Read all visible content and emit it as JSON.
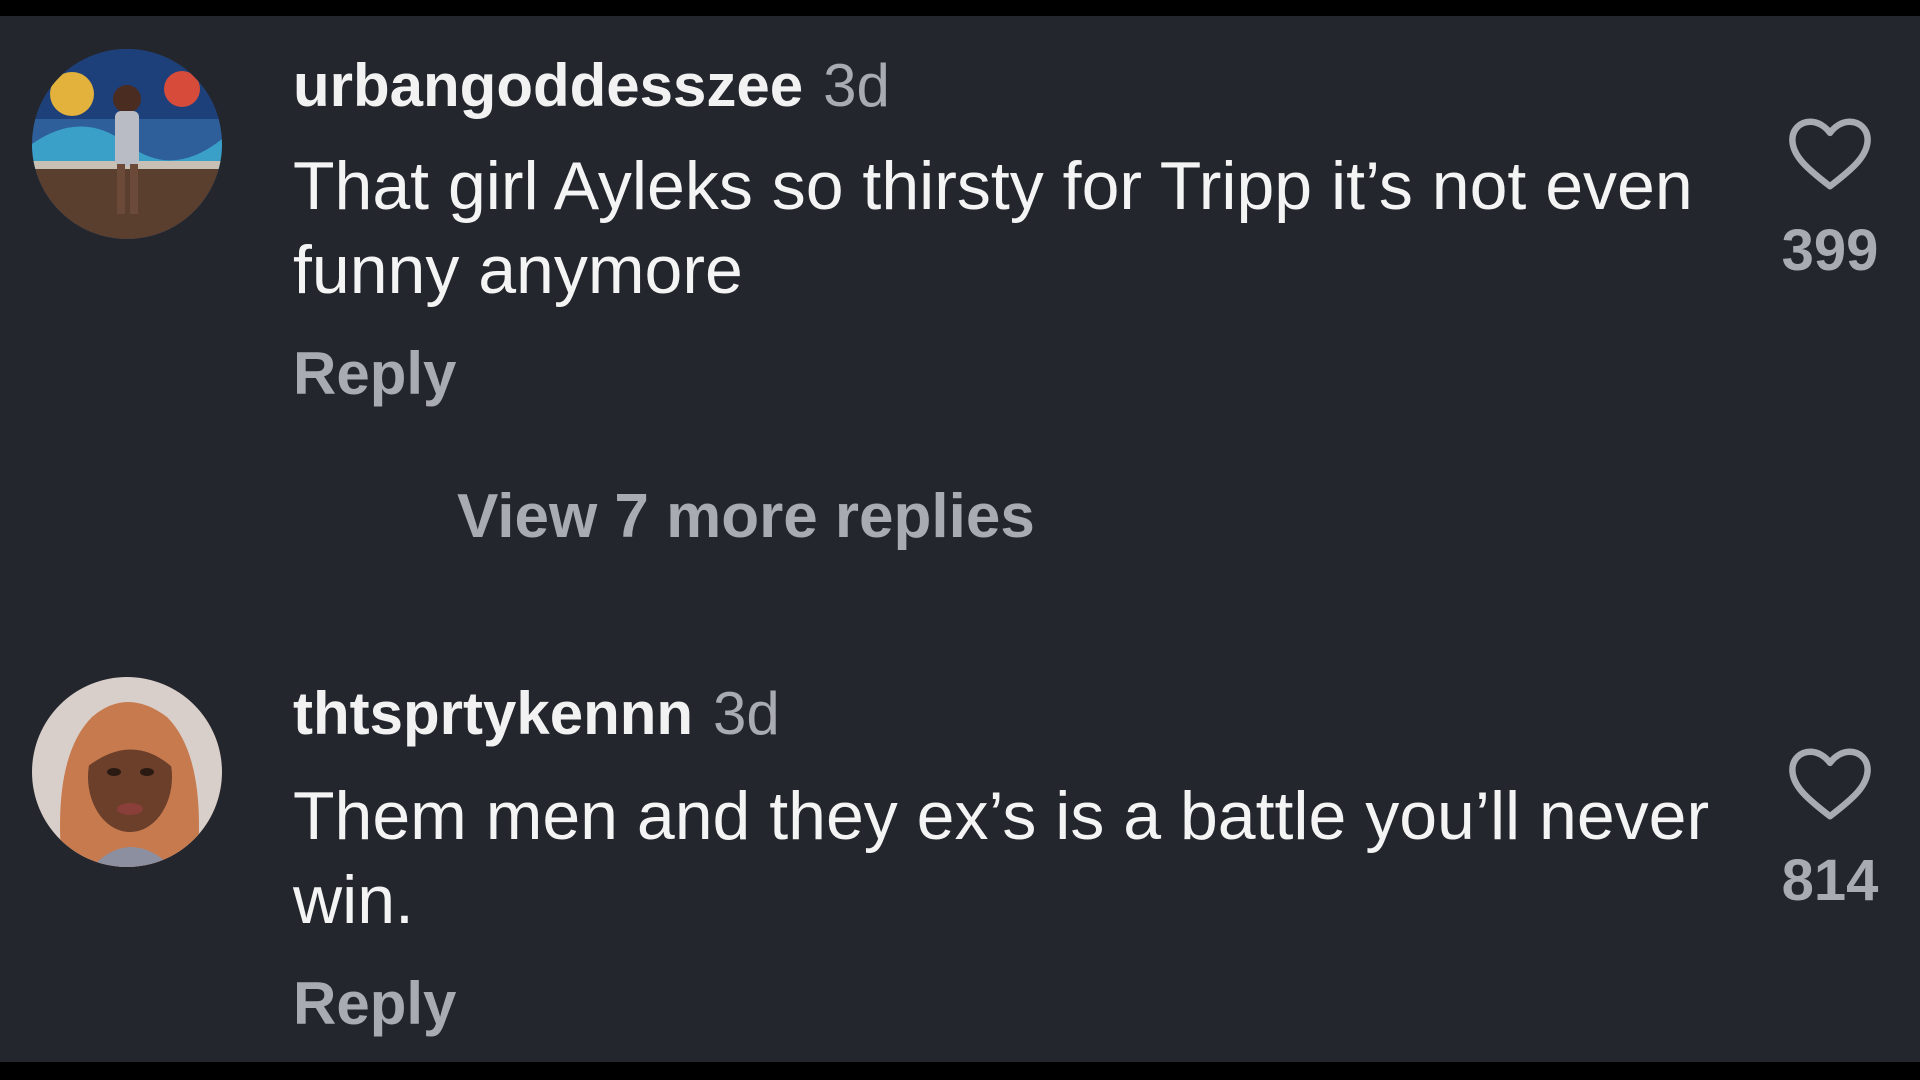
{
  "colors": {
    "background": "#24262d",
    "primary_text": "#f4f4f4",
    "secondary_text": "#a9abb2",
    "outer_bar": "#000000"
  },
  "comments": [
    {
      "username": "urbangoddesszee",
      "time": "3d",
      "text": "That girl Ayleks so thirsty for Tripp it’s not even funny anymore",
      "reply_label": "Reply",
      "like_icon": "heart-outline-icon",
      "like_count": "399"
    },
    {
      "username": "thtsprtykennn",
      "time": "3d",
      "text": "Them men and they ex’s is a battle you’ll never win.",
      "reply_label": "Reply",
      "like_icon": "heart-outline-icon",
      "like_count": "814"
    }
  ],
  "view_more_replies": "View 7 more replies"
}
